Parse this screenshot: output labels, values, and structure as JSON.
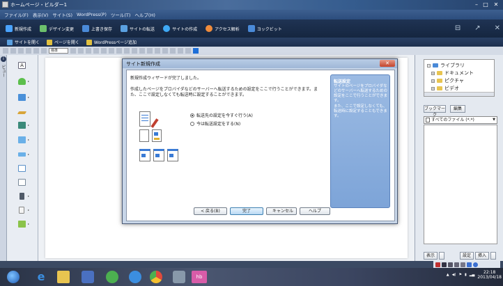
{
  "window": {
    "title": "ホームページ・ビルダー1",
    "controls": [
      "–",
      "□",
      "✕"
    ]
  },
  "menu": {
    "items": [
      "ファイル(F)",
      "表示(V)",
      "サイト(S)",
      "WordPress(P)",
      "ツール(T)",
      "ヘルプ(H)"
    ]
  },
  "toolbar": {
    "items": [
      {
        "label": "新規作成",
        "color": "#4aa3ff"
      },
      {
        "label": "デザイン変更",
        "color": "#6cc06c"
      },
      {
        "label": "上書き保存",
        "color": "#4a8ad8"
      },
      {
        "label": "サイトの転送",
        "color": "#5aa0e0"
      },
      {
        "label": "サイトの作成",
        "color": "#3fa9f5"
      },
      {
        "label": "アクセス解析",
        "color": "#f08c3c"
      },
      {
        "label": "ヨックビット",
        "color": "#4a8ad8"
      }
    ],
    "right_icons": [
      "⊟",
      "↗",
      "✕"
    ]
  },
  "subtoolbar": {
    "items": [
      {
        "label": "サイトを開く",
        "color": "#5aa0e0"
      },
      {
        "label": "ページを開く",
        "color": "#e0c040"
      },
      {
        "label": "WordPressページ追加",
        "color": "#e0c040"
      }
    ],
    "style_select": "標準"
  },
  "left_strip": {
    "text": "ビュー"
  },
  "tools": [
    {
      "name": "text-tool",
      "color": "#ffffff"
    },
    {
      "name": "person-tool",
      "color": "#5cbf4c"
    },
    {
      "name": "image-tool",
      "color": "#4a90d9"
    },
    {
      "name": "pen-tool",
      "color": "#d8a53a"
    },
    {
      "name": "media-tool",
      "color": "#3b8a7a"
    },
    {
      "name": "layout-tool",
      "color": "#6ab0e8"
    },
    {
      "name": "form-tool",
      "color": "#6ab0e8"
    },
    {
      "name": "table-tool",
      "color": "#6ab0e8"
    },
    {
      "name": "list-tool",
      "color": "#a0b0c0"
    },
    {
      "name": "device-tool",
      "color": "#505a68"
    },
    {
      "name": "page-tool",
      "color": "#f4f4f4"
    },
    {
      "name": "parts-tool",
      "color": "#8bc34a"
    }
  ],
  "library": {
    "items": [
      {
        "label": "ライブラリ",
        "sign": "−",
        "color": "#4a8ad8"
      },
      {
        "label": "ドキュメント",
        "sign": "+",
        "color": "#e8c450"
      },
      {
        "label": "ピクチャ",
        "sign": "+",
        "color": "#e8c450"
      },
      {
        "label": "ビデオ",
        "sign": "+",
        "color": "#e8c450"
      }
    ],
    "bookmark_button": "ブックマーク",
    "edit_button": "編集",
    "file_filter": "すべてのファイル (*.*)",
    "view_button": "表示",
    "settings_button": "設定",
    "insert_button": "挿入"
  },
  "dialog": {
    "title": "サイト新規作成",
    "close_glyph": "✕",
    "message1": "新規作成ウィザードが完了しました。",
    "message2": "作成したページをプロバイダなどのサーバーへ転送するための設定をここで行うことができます。また、ここで設定しなくても転送時に設定することができます。",
    "options": [
      {
        "label": "転送先の設定を今すぐ行う(A)",
        "selected": true
      },
      {
        "label": "今は転送設定をする(N)",
        "selected": false
      }
    ],
    "info_title": "転送設定",
    "info_text1": "サイトのページをプロバイダなどのサーバーへ転送するための設定をここで行うことができます。",
    "info_text2": "また、ここで設定しなくても、転送時に設定することもできます。",
    "buttons": {
      "back": "< 戻る(B)",
      "finish": "完了",
      "cancel": "キャンセル",
      "help": "ヘルプ"
    }
  },
  "taskbar": {
    "apps": [
      {
        "name": "ie",
        "color": "#3b8ee0"
      },
      {
        "name": "explorer",
        "color": "#e8c450"
      },
      {
        "name": "media",
        "color": "#4a70c0"
      },
      {
        "name": "game",
        "color": "#4caf50"
      },
      {
        "name": "network",
        "color": "#3b8ee0"
      },
      {
        "name": "chrome",
        "color": "#e04a3c"
      },
      {
        "name": "tools",
        "color": "#8899aa"
      },
      {
        "name": "hpb",
        "color": "#d85ca8"
      }
    ],
    "time": "22:18",
    "date": "2013/04/18"
  }
}
